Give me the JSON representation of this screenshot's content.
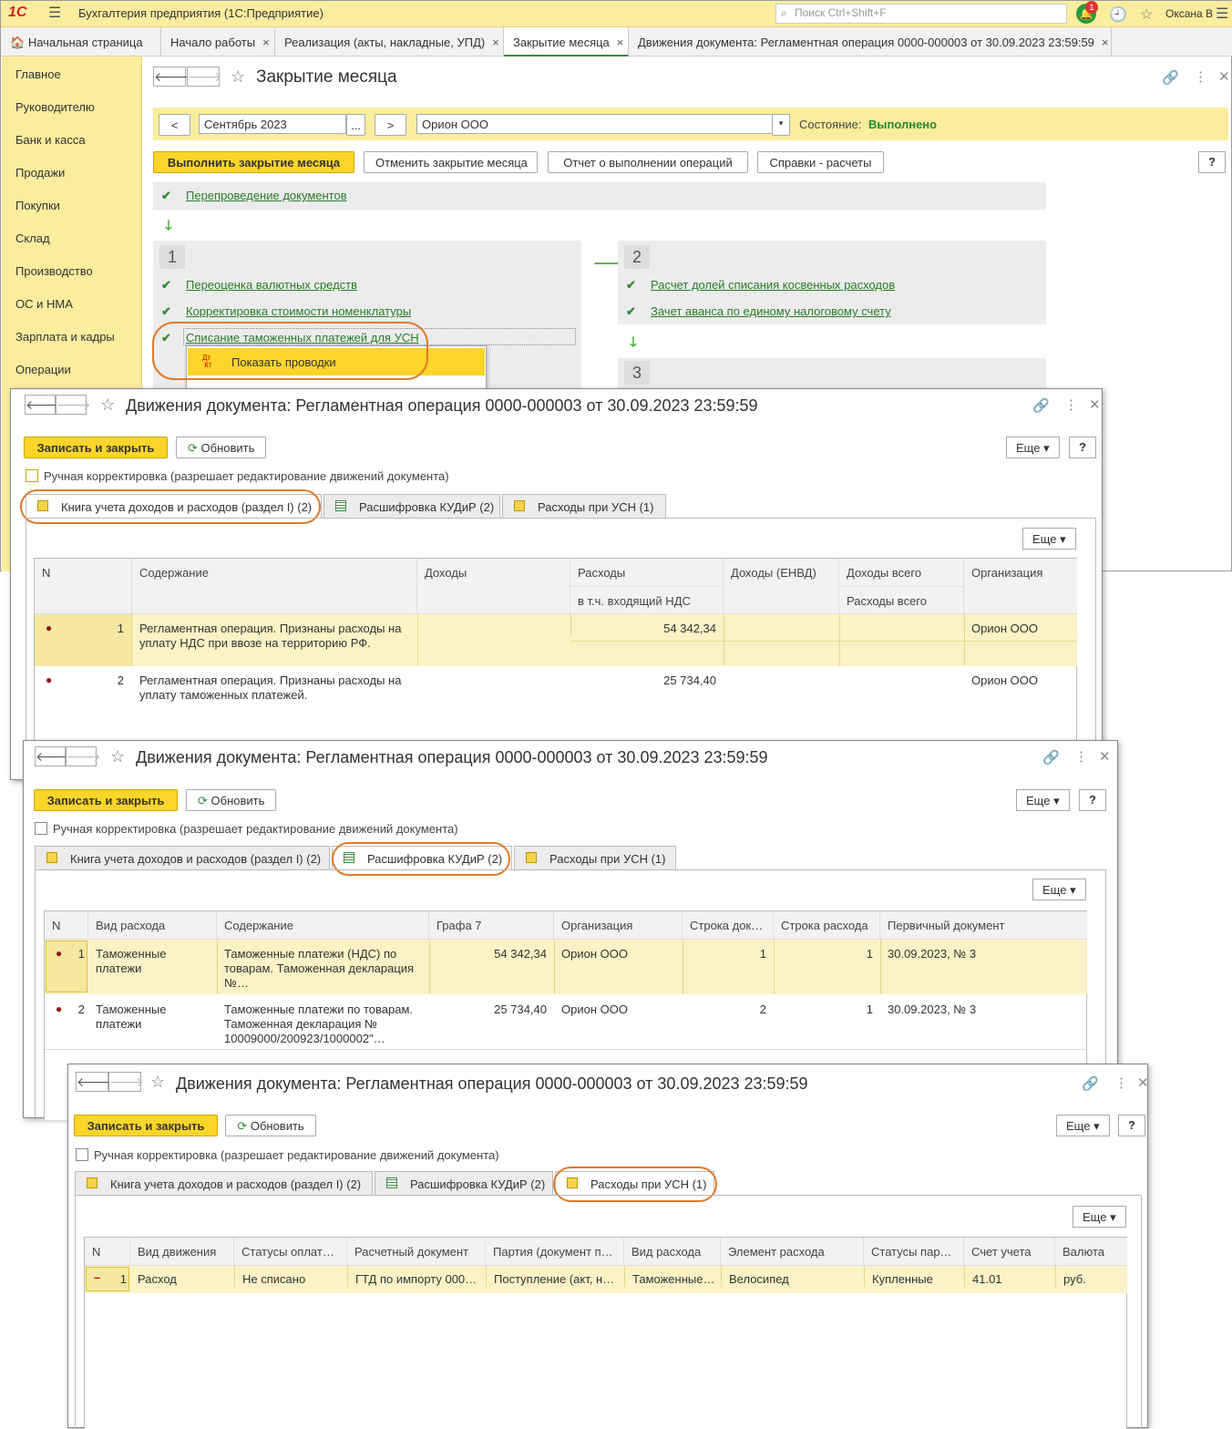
{
  "app": {
    "logo": "1С",
    "title": "Бухгалтерия предприятия (1С:Предприятие)",
    "search_placeholder": "Поиск Ctrl+Shift+F",
    "notifications": "1",
    "user": "Оксана В"
  },
  "tabs": [
    {
      "label": "Начальная страница"
    },
    {
      "label": "Начало работы"
    },
    {
      "label": "Реализация (акты, накладные, УПД)"
    },
    {
      "label": "Закрытие месяца"
    },
    {
      "label": "Движения документа: Регламентная операция 0000-000003 от 30.09.2023 23:59:59"
    }
  ],
  "sidebar": [
    "Главное",
    "Руководителю",
    "Банк и касса",
    "Продажи",
    "Покупки",
    "Склад",
    "Производство",
    "ОС и НМА",
    "Зарплата и кадры",
    "Операции"
  ],
  "closing": {
    "title": "Закрытие месяца",
    "prev": "<",
    "next": ">",
    "dots": "...",
    "period": "Сентябрь 2023",
    "org": "Орион ООО",
    "state_label": "Состояние:",
    "state_value": "Выполнено",
    "btn_run": "Выполнить закрытие месяца",
    "btn_cancel": "Отменить закрытие месяца",
    "btn_report": "Отчет о выполнении операций",
    "btn_refs": "Справки - расчеты",
    "help": "?",
    "reposting": "Перепроведение документов",
    "step1": "1",
    "step1_items": [
      "Переоценка валютных средств",
      "Корректировка стоимости номенклатуры",
      "Списание таможенных платежей для УСН"
    ],
    "step2": "2",
    "step2_items": [
      "Расчет долей списания косвенных расходов",
      "Зачет аванса по единому налоговому счету"
    ],
    "step3": "3",
    "popup_item": "Показать проводки"
  },
  "win_common": {
    "title": "Движения документа: Регламентная операция 0000-000003 от 30.09.2023 23:59:59",
    "save_close": "Записать и закрыть",
    "refresh": "Обновить",
    "more": "Еще",
    "help": "?",
    "manual": "Ручная корректировка (разрешает редактирование движений документа)",
    "tab1": "Книга учета доходов и расходов (раздел I) (2)",
    "tab2": "Расшифровка КУДиР (2)",
    "tab3": "Расходы при УСН (1)"
  },
  "win1": {
    "headers": {
      "n": "N",
      "content": "Содержание",
      "income": "Доходы",
      "expense": "Расходы",
      "vat": "в т.ч. входящий НДС",
      "envd": "Доходы (ЕНВД)",
      "income_total": "Доходы всего",
      "expense_total": "Расходы всего",
      "org": "Организация"
    },
    "rows": [
      {
        "n": "1",
        "content": "Регламентная операция. Признаны расходы на уплату НДС при ввозе на территорию РФ.",
        "expense": "54 342,34",
        "org": "Орион ООО"
      },
      {
        "n": "2",
        "content": "Регламентная операция. Признаны расходы на уплату таможенных платежей.",
        "expense": "25 734,40",
        "org": "Орион ООО"
      }
    ]
  },
  "win2": {
    "headers": [
      "N",
      "Вид расхода",
      "Содержание",
      "Графа 7",
      "Организация",
      "Строка док…",
      "Строка расхода",
      "Первичный документ"
    ],
    "rows": [
      {
        "n": "1",
        "kind": "Таможенные платежи",
        "content": "Таможенные платежи (НДС) по товарам. Таможенная декларация №…",
        "g7": "54 342,34",
        "org": "Орион ООО",
        "line_doc": "1",
        "line_exp": "1",
        "doc": "30.09.2023, № 3"
      },
      {
        "n": "2",
        "kind": "Таможенные платежи",
        "content": "Таможенные платежи по товарам. Таможенная декларация № 10009000/200923/1000002\"…",
        "g7": "25 734,40",
        "org": "Орион ООО",
        "line_doc": "2",
        "line_exp": "1",
        "doc": "30.09.2023, № 3"
      }
    ]
  },
  "win3": {
    "headers": [
      "N",
      "Вид движения",
      "Статусы оплаты…",
      "Расчетный документ",
      "Партия (документ п…",
      "Вид расхода",
      "Элемент расхода",
      "Статусы парт…",
      "Счет учета",
      "Валюта"
    ],
    "row": {
      "minus": "–",
      "n": "1",
      "move": "Расход",
      "pay": "Не списано",
      "doc": "ГТД по импорту 000…",
      "batch": "Поступление (акт, н…",
      "kind": "Таможенные…",
      "element": "Велосипед",
      "bstatus": "Купленные",
      "account": "41.01",
      "cur": "руб."
    }
  },
  "colors": {
    "accent_yellow": "#fbd529",
    "panel_yellow": "#fbed9e",
    "link_green": "#2a7a2a",
    "highlight_orange": "#e07a2a"
  }
}
